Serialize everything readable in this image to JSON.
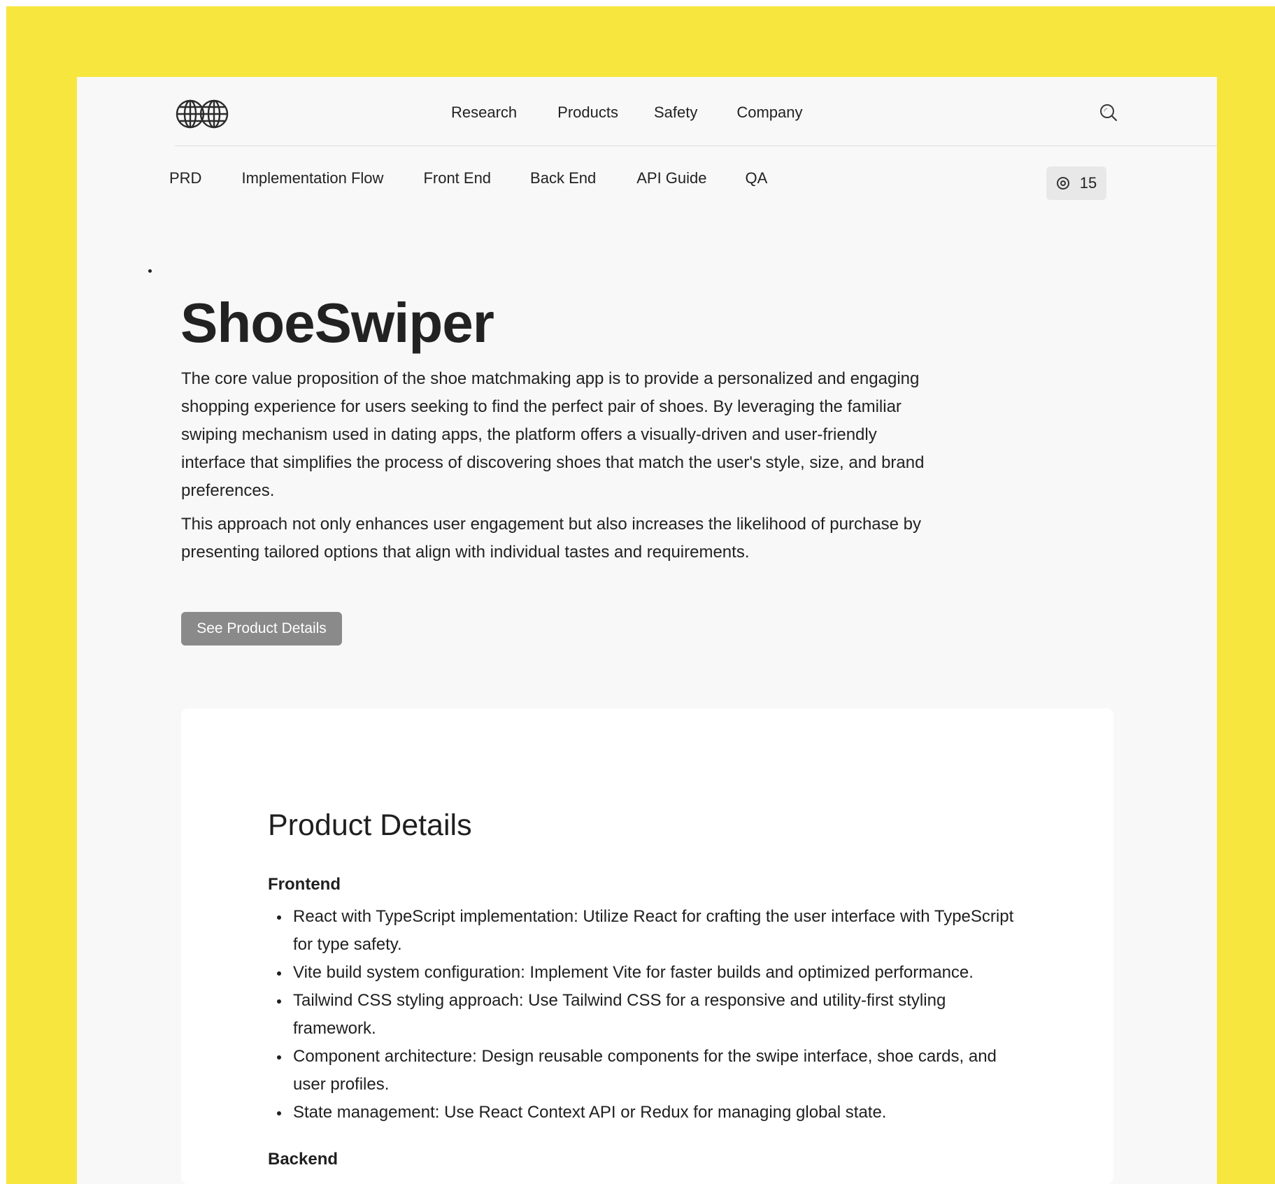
{
  "nav": {
    "items": [
      "Research",
      "Products",
      "Safety",
      "Company"
    ]
  },
  "tabs": {
    "items": [
      "PRD",
      "Implementation Flow",
      "Front End",
      "Back End",
      "API Guide",
      "QA"
    ]
  },
  "counter": {
    "value": "15",
    "icon": "target-icon"
  },
  "hero": {
    "title": "ShoeSwiper",
    "paragraph_1": "The core value proposition of the shoe matchmaking app is to provide a personalized and engaging shopping experience for users seeking to find the perfect pair of shoes. By leveraging the familiar swiping mechanism used in dating apps, the platform offers a visually-driven and user-friendly interface that simplifies the process of discovering shoes that match the user's style, size, and brand preferences.",
    "paragraph_2": "This approach not only enhances user engagement but also increases the likelihood of purchase by presenting tailored options that align with individual tastes and requirements.",
    "button_label": "See Product Details"
  },
  "details": {
    "title": "Product Details",
    "frontend_heading": "Frontend",
    "frontend_items": [
      "React with TypeScript implementation: Utilize React for crafting the user interface with TypeScript for type safety.",
      "Vite build system configuration: Implement Vite for faster builds and optimized performance.",
      "Tailwind CSS styling approach: Use Tailwind CSS for a responsive and utility-first styling framework.",
      "Component architecture: Design reusable components for the swipe interface, shoe cards, and user profiles.",
      "State management: Use React Context API or Redux for managing global state."
    ],
    "backend_heading": "Backend"
  },
  "colors": {
    "frame": "#f7e63e",
    "page_background": "#f8f8f8",
    "button": "#8a8a8a",
    "counter_background": "#e8e8e8"
  }
}
